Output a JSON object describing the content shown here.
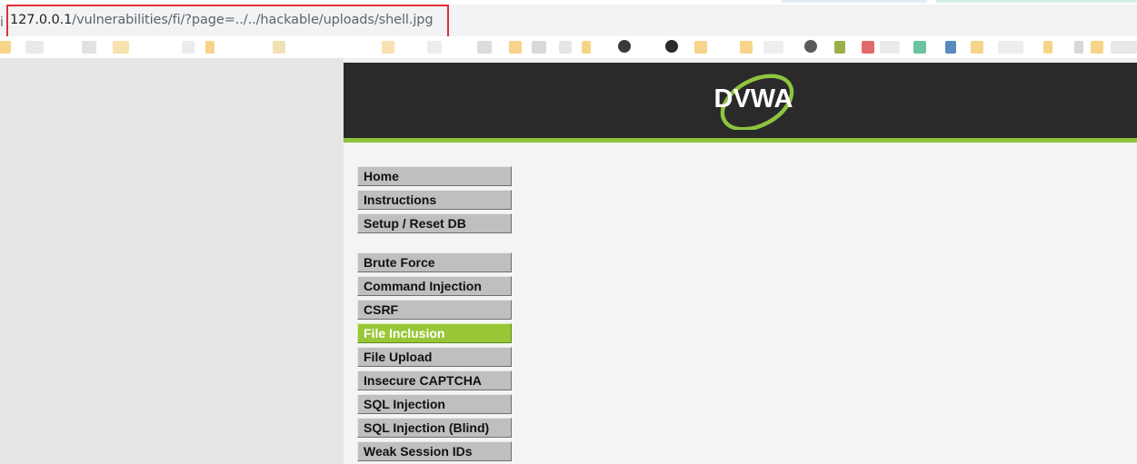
{
  "browser": {
    "url_host": "127.0.0.1",
    "url_path": "/vulnerabilities/fi/?page=../../hackable/uploads/shell.jpg",
    "address_icon": "i",
    "highlight_color": "#e0303a",
    "bookmark_icons": [
      "folder-icon",
      "page-icon",
      "github-icon",
      "globe-icon",
      "python-icon",
      "folder-icon"
    ]
  },
  "dvwa": {
    "logo_text": "DVWA",
    "accent_color": "#8ec43f",
    "header_color": "#2a2a2a",
    "menu_groups": [
      [
        {
          "label": "Home",
          "active": false
        },
        {
          "label": "Instructions",
          "active": false
        },
        {
          "label": "Setup / Reset DB",
          "active": false
        }
      ],
      [
        {
          "label": "Brute Force",
          "active": false
        },
        {
          "label": "Command Injection",
          "active": false
        },
        {
          "label": "CSRF",
          "active": false
        },
        {
          "label": "File Inclusion",
          "active": true
        },
        {
          "label": "File Upload",
          "active": false
        },
        {
          "label": "Insecure CAPTCHA",
          "active": false
        },
        {
          "label": "SQL Injection",
          "active": false
        },
        {
          "label": "SQL Injection (Blind)",
          "active": false
        },
        {
          "label": "Weak Session IDs",
          "active": false
        }
      ]
    ]
  }
}
